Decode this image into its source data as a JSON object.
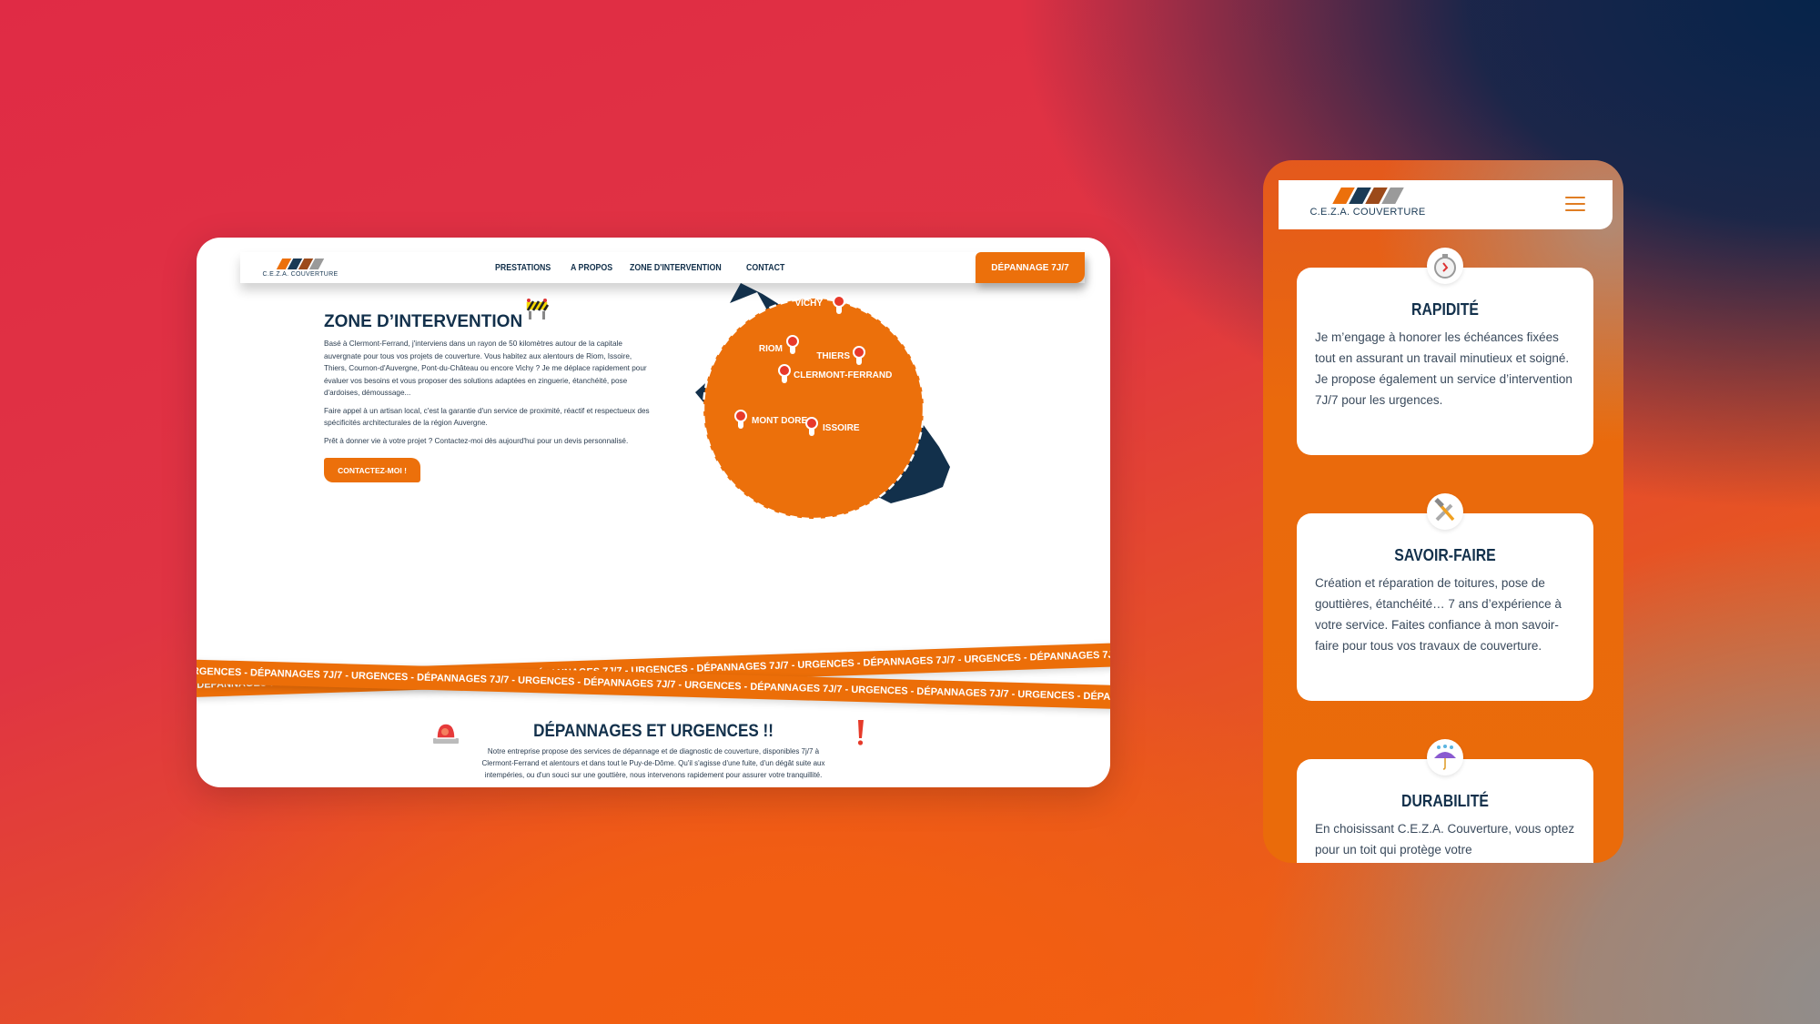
{
  "desktop": {
    "logo_text": "C.E.Z.A. COUVERTURE",
    "logo_colors": [
      "#ec700b",
      "#1a3a55",
      "#9c4a1a",
      "#9a9a9a"
    ],
    "nav": [
      {
        "label": "PRESTATIONS"
      },
      {
        "label": "A PROPOS"
      },
      {
        "label": "ZONE D'INTERVENTION"
      },
      {
        "label": "CONTACT"
      }
    ],
    "cta_label": "DÉPANNAGE 7J/7",
    "zone": {
      "title": "ZONE D’INTERVENTION",
      "paragraphs": [
        "Basé à Clermont-Ferrand, j'interviens dans un rayon de 50 kilomètres autour de la capitale auvergnate pour tous vos projets de couverture. Vous habitez aux alentours de Riom, Issoire, Thiers, Cournon-d'Auvergne, Pont-du-Château ou encore Vichy ? Je me déplace rapidement pour évaluer vos besoins et vous proposer des solutions adaptées en zinguerie, étanchéité, pose d'ardoises, démoussage...",
        "Faire appel à un artisan local, c'est la garantie d'un service de proximité, réactif et respectueux des spécificités architecturales de la région Auvergne.",
        "Prêt à donner vie à votre projet ? Contactez-moi dès aujourd'hui pour un devis personnalisé."
      ],
      "button_label": "CONTACTEZ-MOI !"
    },
    "map": {
      "cities": [
        {
          "name": "VICHY"
        },
        {
          "name": "RIOM"
        },
        {
          "name": "THIERS"
        },
        {
          "name": "CLERMONT-FERRAND"
        },
        {
          "name": "MONT DORE"
        },
        {
          "name": "ISSOIRE"
        }
      ],
      "region_color": "#12304b",
      "zone_color": "#ec700b",
      "pin_color": "#e8392a"
    },
    "tape_text": "DÉPANNAGES 7J/7  -  URGENCES  -  DÉPANNAGES 7J/7  -  URGENCES  -  DÉPANNAGES 7J/7  -  URGENCES  -  DÉPANNAGES 7J/7  -  URGENCES  -  DÉPANNAGES 7J/7  -  URGENCES  -  DÉPANNAGES 7J/7  -  URGENCES",
    "tape_text_2": "-  URGENCES  -  DÉPANNAGES 7J/7  -  URGENCES  -  DÉPANNAGES 7J/7  -  URGENCES  -  DÉPANNAGES 7J/7  -  URGENCES  -  DÉPANNAGES 7J/7  -  URGENCES  -  DÉPANNAGES 7J/7  -  URGENCES  -  DÉPANNAGES 7J/7",
    "urgences": {
      "title": "DÉPANNAGES ET URGENCES !!",
      "text": "Notre entreprise propose des services de dépannage et de diagnostic de couverture, disponibles 7j/7 à Clermont-Ferrand et alentours et dans tout le Puy-de-Dôme. Qu'il s'agisse d'une fuite, d'un dégât suite aux intempéries, ou d'un souci sur une gouttière, nous intervenons rapidement pour assurer votre tranquillité."
    }
  },
  "mobile": {
    "logo_text": "C.E.Z.A. COUVERTURE",
    "menu_icon": "hamburger-icon",
    "cards": [
      {
        "icon": "stopwatch-icon",
        "title": "RAPIDITÉ",
        "text": "Je m’engage à honorer les échéances fixées tout en assurant un travail minutieux et soigné. Je propose également un service d’intervention 7J/7 pour les urgences."
      },
      {
        "icon": "hammer-wrench-icon",
        "title": "SAVOIR-FAIRE",
        "text": "Création et réparation de toitures, pose de gouttières, étanchéité… 7 ans d’expérience à votre service. Faites confiance à mon savoir-faire pour tous vos travaux de couverture."
      },
      {
        "icon": "umbrella-rain-icon",
        "title": "DURABILITÉ",
        "text": "En choisissant C.E.Z.A. Couverture, vous optez pour un toit qui protège votre"
      }
    ]
  }
}
